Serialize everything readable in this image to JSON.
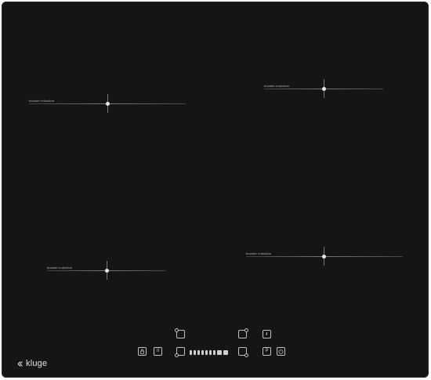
{
  "zones": [
    {
      "label": "booster induction"
    },
    {
      "label": "booster induction"
    },
    {
      "label": "booster induction"
    },
    {
      "label": "booster induction"
    }
  ],
  "controls": {
    "lock_icon": "lock-icon",
    "pause_symbol": "II",
    "power_symbol": "P",
    "timer_icon": "clock-icon",
    "power_button_icon": "power-icon",
    "slider_levels": 9
  },
  "brand": {
    "name": "kluge"
  },
  "colors": {
    "surface": "#151515",
    "graphics": "#cfcfcf"
  }
}
